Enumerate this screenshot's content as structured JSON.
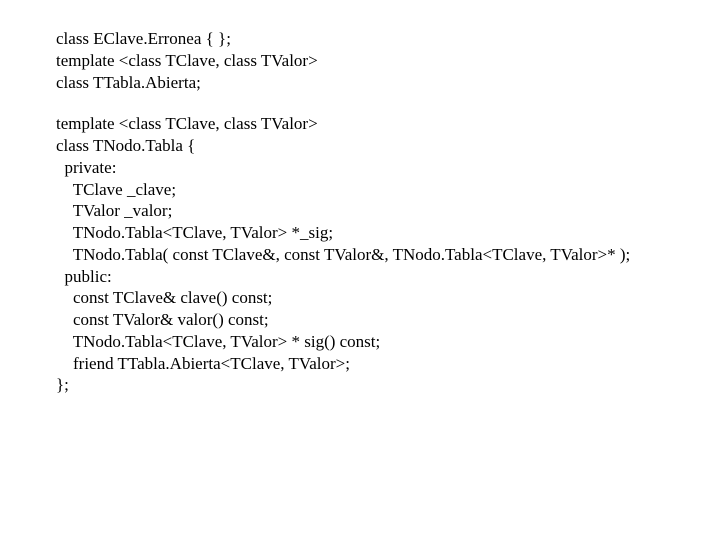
{
  "code": {
    "l01": "class EClave.Erronea { };",
    "l02": "template <class TClave, class TValor>",
    "l03": "class TTabla.Abierta;",
    "l04": "template <class TClave, class TValor>",
    "l05": "class TNodo.Tabla {",
    "l06": "  private:",
    "l07": "    TClave _clave;",
    "l08": "    TValor _valor;",
    "l09": "    TNodo.Tabla<TClave, TValor> *_sig;",
    "l10": "    TNodo.Tabla( const TClave&, const TValor&, TNodo.Tabla<TClave, TValor>* );",
    "l11": "  public:",
    "l12": "    const TClave& clave() const;",
    "l13": "    const TValor& valor() const;",
    "l14": "    TNodo.Tabla<TClave, TValor> * sig() const;",
    "l15": "    friend TTabla.Abierta<TClave, TValor>;",
    "l16": "};"
  }
}
